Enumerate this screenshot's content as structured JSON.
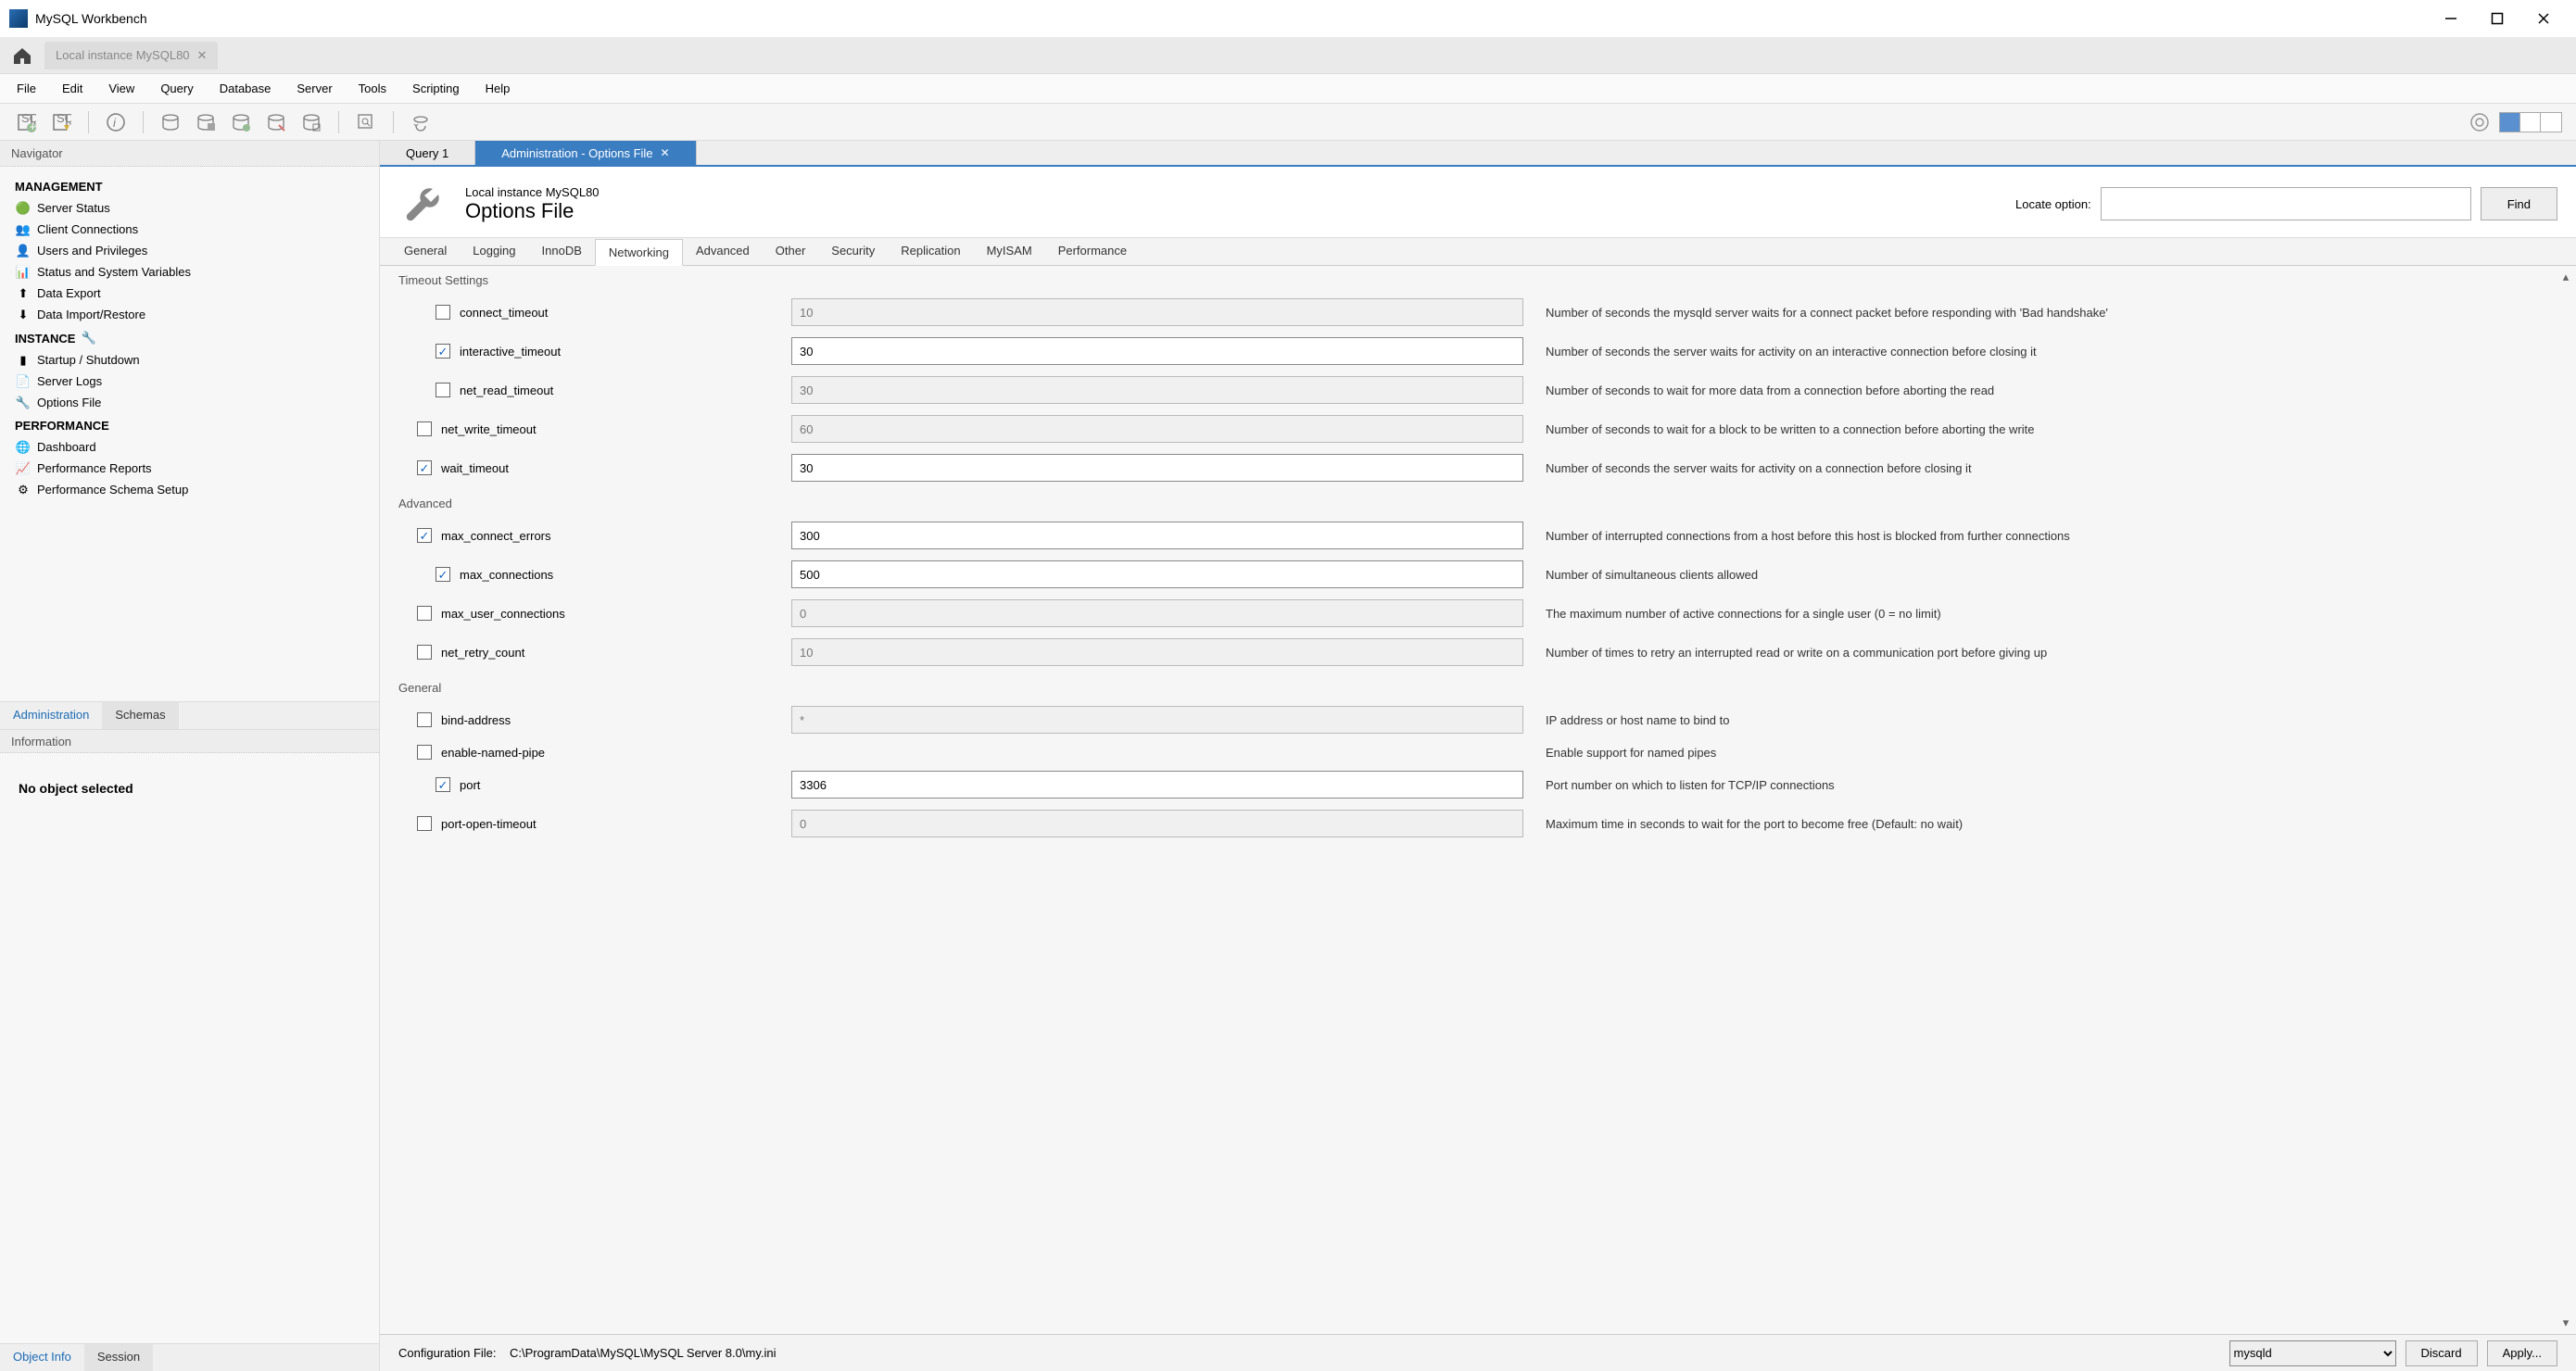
{
  "window": {
    "title": "MySQL Workbench"
  },
  "conn_tab": {
    "label": "Local instance MySQL80"
  },
  "menubar": [
    "File",
    "Edit",
    "View",
    "Query",
    "Database",
    "Server",
    "Tools",
    "Scripting",
    "Help"
  ],
  "sidebar": {
    "navigator_label": "Navigator",
    "management": {
      "title": "MANAGEMENT",
      "items": [
        "Server Status",
        "Client Connections",
        "Users and Privileges",
        "Status and System Variables",
        "Data Export",
        "Data Import/Restore"
      ]
    },
    "instance": {
      "title": "INSTANCE",
      "items": [
        "Startup / Shutdown",
        "Server Logs",
        "Options File"
      ]
    },
    "performance": {
      "title": "PERFORMANCE",
      "items": [
        "Dashboard",
        "Performance Reports",
        "Performance Schema Setup"
      ]
    },
    "tabs": {
      "admin": "Administration",
      "schemas": "Schemas"
    },
    "info_label": "Information",
    "no_object": "No object selected",
    "bottom_tabs": {
      "object": "Object Info",
      "session": "Session"
    }
  },
  "content_tabs": {
    "query": "Query 1",
    "admin": "Administration - Options File"
  },
  "page_header": {
    "subtitle": "Local instance MySQL80",
    "title": "Options File",
    "locate_label": "Locate option:",
    "find_button": "Find"
  },
  "option_tabs": [
    "General",
    "Logging",
    "InnoDB",
    "Networking",
    "Advanced",
    "Other",
    "Security",
    "Replication",
    "MyISAM",
    "Performance"
  ],
  "groups": {
    "timeout": {
      "title": "Timeout Settings",
      "rows": [
        {
          "name": "connect_timeout",
          "checked": false,
          "value": "10",
          "indent": true,
          "desc": "Number of seconds the mysqld server waits for a connect packet before responding with 'Bad handshake'"
        },
        {
          "name": "interactive_timeout",
          "checked": true,
          "value": "30",
          "indent": true,
          "desc": "Number of seconds the server waits for activity on an interactive connection before closing it"
        },
        {
          "name": "net_read_timeout",
          "checked": false,
          "value": "30",
          "indent": true,
          "desc": "Number of seconds to wait for more data from a connection before aborting the read"
        },
        {
          "name": "net_write_timeout",
          "checked": false,
          "value": "60",
          "indent": false,
          "desc": "Number of seconds to wait for a block to be written to a connection before aborting the write"
        },
        {
          "name": "wait_timeout",
          "checked": true,
          "value": "30",
          "indent": false,
          "desc": "Number of seconds the server waits for activity on a connection before closing it"
        }
      ]
    },
    "advanced": {
      "title": "Advanced",
      "rows": [
        {
          "name": "max_connect_errors",
          "checked": true,
          "value": "300",
          "indent": false,
          "desc": "Number of interrupted connections from a host before this host is blocked from further connections"
        },
        {
          "name": "max_connections",
          "checked": true,
          "value": "500",
          "indent": true,
          "desc": "Number of simultaneous clients allowed"
        },
        {
          "name": "max_user_connections",
          "checked": false,
          "value": "0",
          "indent": false,
          "desc": "The maximum number of active connections for a single user (0 = no limit)"
        },
        {
          "name": "net_retry_count",
          "checked": false,
          "value": "10",
          "indent": false,
          "desc": "Number of times to retry an interrupted read or write on a communication port before giving up"
        }
      ]
    },
    "general": {
      "title": "General",
      "rows": [
        {
          "name": "bind-address",
          "checked": false,
          "value": "*",
          "indent": false,
          "desc": "IP address or host name to bind to"
        },
        {
          "name": "enable-named-pipe",
          "checked": false,
          "value": null,
          "indent": false,
          "desc": "Enable support for named pipes"
        },
        {
          "name": "port",
          "checked": true,
          "value": "3306",
          "indent": true,
          "desc": "Port number on which to listen for TCP/IP connections"
        },
        {
          "name": "port-open-timeout",
          "checked": false,
          "value": "0",
          "indent": false,
          "desc": "Maximum time in seconds to wait for the port to become free (Default: no wait)"
        }
      ]
    }
  },
  "status": {
    "config_label": "Configuration File:",
    "config_path": "C:\\ProgramData\\MySQL\\MySQL Server 8.0\\my.ini",
    "section": "mysqld",
    "discard": "Discard",
    "apply": "Apply..."
  }
}
